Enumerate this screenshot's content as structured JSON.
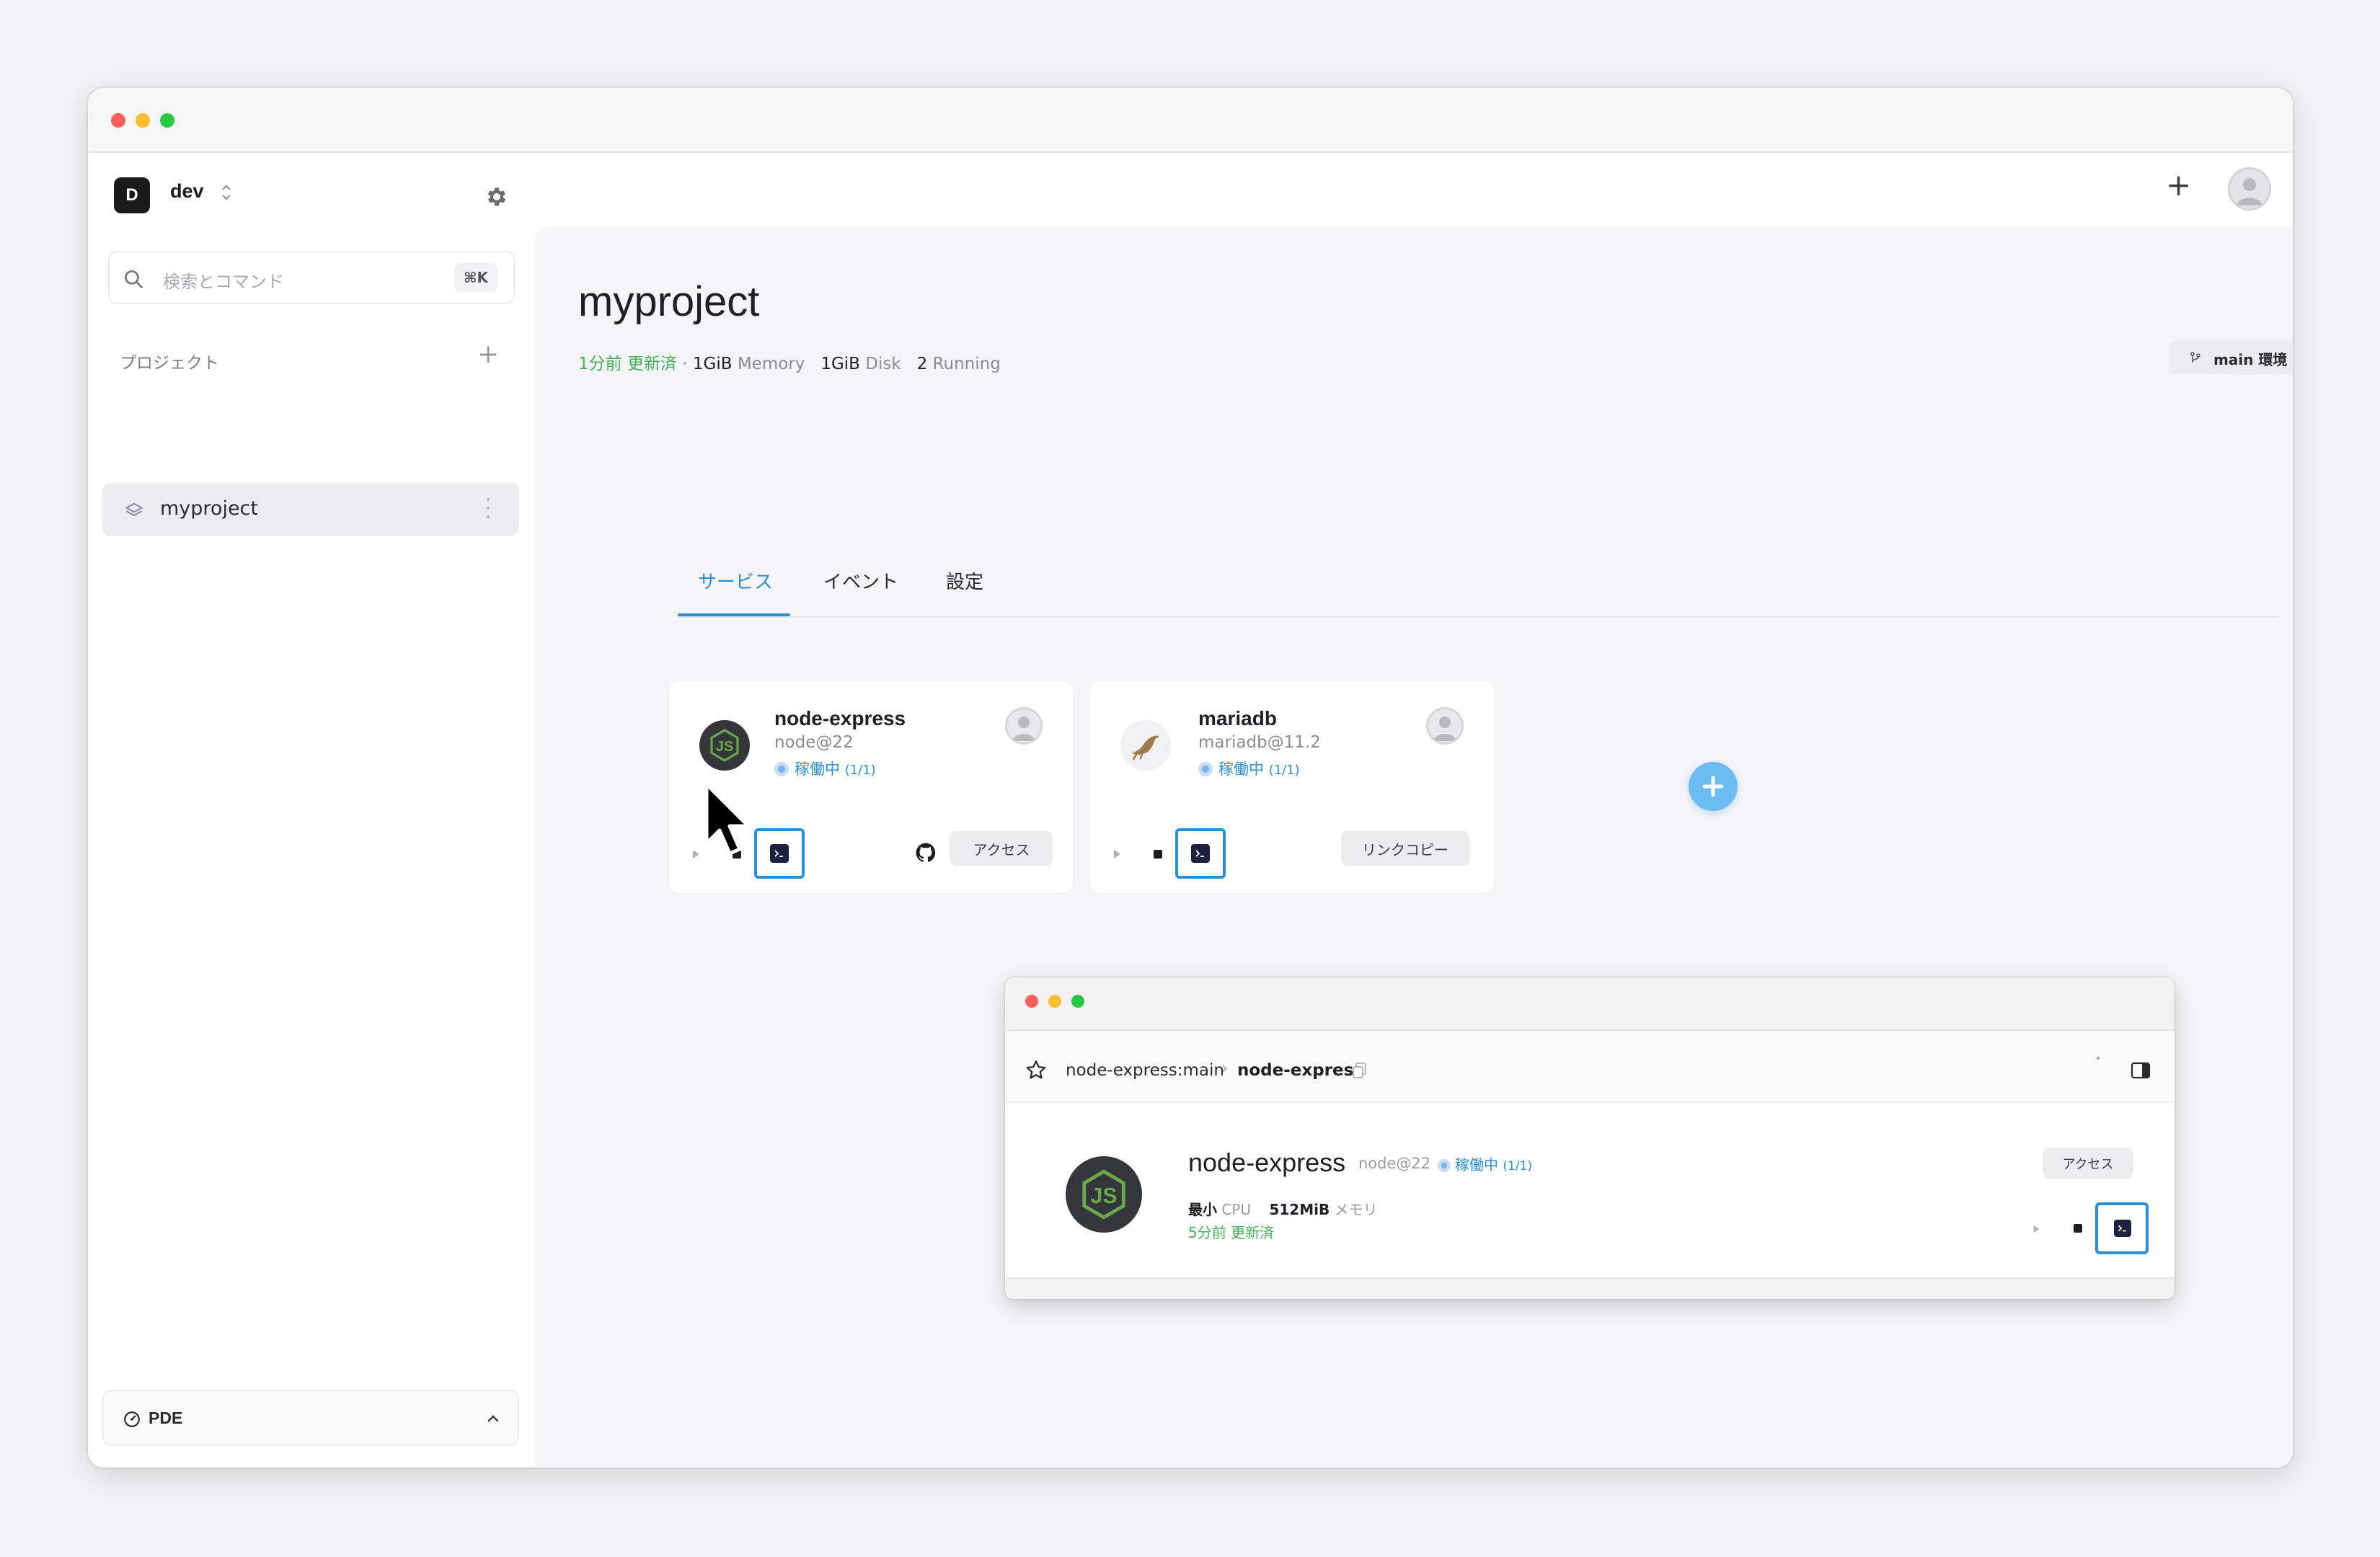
{
  "workspace": {
    "badge": "D",
    "name": "dev"
  },
  "sidebar": {
    "search": {
      "placeholder": "検索とコマンド",
      "shortcut": "⌘K"
    },
    "projects_heading": "プロジェクト",
    "projects": [
      {
        "label": "myproject"
      }
    ],
    "footer": {
      "label": "PDE"
    }
  },
  "header": {
    "add_icon": "plus-icon",
    "avatar_icon": "user-avatar"
  },
  "project": {
    "title": "myproject",
    "updated": "1分前 更新済",
    "memory_value": "1GiB",
    "memory_label": "Memory",
    "disk_value": "1GiB",
    "disk_label": "Disk",
    "running_value": "2",
    "running_label": "Running",
    "env_button": "main 環境"
  },
  "tabs": [
    {
      "label": "サービス",
      "active": true
    },
    {
      "label": "イベント",
      "active": false
    },
    {
      "label": "設定",
      "active": false
    }
  ],
  "services": [
    {
      "name": "node-express",
      "version": "node@22",
      "status": "稼働中",
      "status_count": "(1/1)",
      "action_button": "アクセス",
      "logo_icon": "nodejs-icon",
      "has_github": true
    },
    {
      "name": "mariadb",
      "version": "mariadb@11.2",
      "status": "稼働中",
      "status_count": "(1/1)",
      "action_button": "リンクコピー",
      "logo_icon": "mariadb-seal-icon",
      "has_github": false
    }
  ],
  "detail_window": {
    "breadcrumb_repo": "node-express:main",
    "breadcrumb_service": "node-express",
    "service_name": "node-express",
    "version": "node@22",
    "status": "稼働中",
    "status_count": "(1/1)",
    "cpu_value": "最小",
    "cpu_label": "CPU",
    "memory_value": "512MiB",
    "memory_label": "メモリ",
    "updated": "5分前 更新済",
    "action_button": "アクセス"
  },
  "colors": {
    "accent": "#2a8fd6",
    "success": "#45b05a",
    "fab": "#6bbcf0",
    "node_green": "#6aa84f"
  }
}
